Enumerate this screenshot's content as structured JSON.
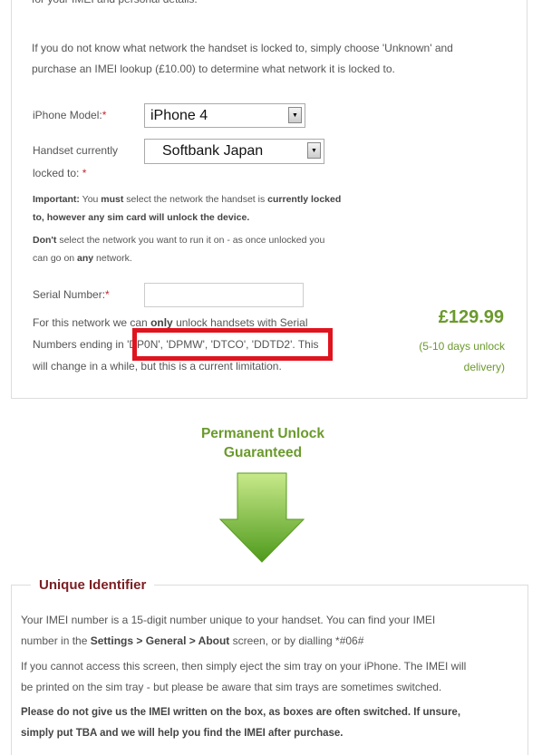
{
  "intro_cut": "for your IMEI and personal details.",
  "unknown_note": [
    "If you do not know what network the handset is locked to, simply choose 'Unknown' and",
    "purchase an IMEI lookup (£10.00) to determine what network it is locked to."
  ],
  "form": {
    "model_label": "iPhone Model:",
    "model_value": "iPhone 4",
    "network_label_1": "Handset currently",
    "network_label_2": "locked to:",
    "network_value": "Softbank Japan",
    "required_mark": "*",
    "serial_label": "Serial Number:",
    "serial_value": ""
  },
  "important": {
    "l1_b1": "Important:",
    "l1_t1": " You ",
    "l1_b2": "must",
    "l1_t2": " select the network the handset is ",
    "l1_b3": "currently locked",
    "l2_b": "to, however any sim card will unlock the device.",
    "l3_b": "Don't",
    "l3_t": " select the network you want to run it on - as once unlocked you",
    "l4_t1": "can go on ",
    "l4_b": "any",
    "l4_t2": " network."
  },
  "serial_note": {
    "l1_t1": "For this network we can ",
    "l1_b": "only",
    "l1_t2": " unlock handsets with Serial",
    "l2_t1": "Numbers ending in ",
    "l2_codes": "'DP0N', 'DPMW', 'DTCO', 'DDTD2'.",
    "l2_t2": " This",
    "l3": "will change in a while, but this is a current limitation."
  },
  "price": {
    "amount": "£129.99",
    "delivery_1": "(5-10 days unlock",
    "delivery_2": "delivery)"
  },
  "guarantee": {
    "line1": "Permanent Unlock",
    "line2": "Guaranteed"
  },
  "unique_identifier": {
    "legend": "Unique Identifier",
    "p1_l1": "Your IMEI number is a 15-digit number unique to your handset. You can find your IMEI",
    "p1_l2_t1": "number in the ",
    "p1_l2_b": "Settings > General > About",
    "p1_l2_t2": " screen, or by dialling *#06#",
    "p2_l1": "If you cannot access this screen, then simply eject the sim tray on your iPhone. The IMEI will",
    "p2_l2": "be printed on the sim tray - but please be aware that sim trays are sometimes switched.",
    "p3_l1": "Please do not give us the IMEI written on the box, as boxes are often switched. If unsure,",
    "p3_l2": "simply put TBA and we will help you find the IMEI after purchase."
  },
  "colors": {
    "accent_green": "#6b9a2c",
    "legend_red": "#7b1d22",
    "highlight_red": "#e0141e"
  }
}
